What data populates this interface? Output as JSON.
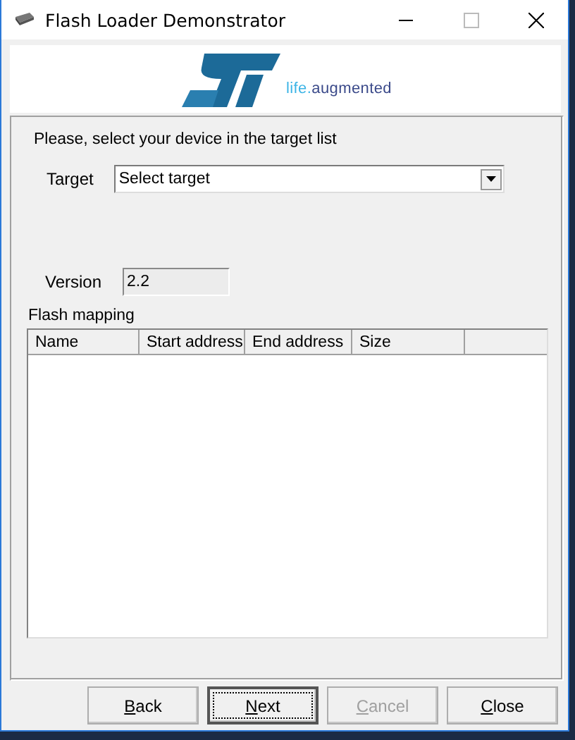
{
  "window": {
    "title": "Flash Loader Demonstrator"
  },
  "logo": {
    "tagline_prefix": "life.",
    "tagline": "augmented"
  },
  "instruction": "Please, select your device in the target list",
  "target": {
    "label": "Target",
    "value": "Select target"
  },
  "version": {
    "label": "Version",
    "value": "2.2"
  },
  "flash_mapping": {
    "title": "Flash mapping",
    "columns": [
      "Name",
      "Start address",
      "End address",
      "Size"
    ]
  },
  "buttons": [
    {
      "label": "Back",
      "focused": false,
      "disabled": false
    },
    {
      "label": "Next",
      "focused": true,
      "disabled": false
    },
    {
      "label": "Cancel",
      "focused": false,
      "disabled": true
    },
    {
      "label": "Close",
      "focused": false,
      "disabled": false
    }
  ]
}
